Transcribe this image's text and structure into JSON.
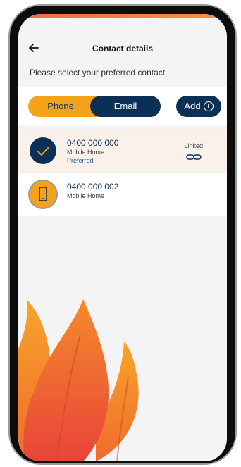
{
  "header": {
    "title": "Contact details"
  },
  "prompt": "Please select your preferred contact",
  "toggle": {
    "phone_label": "Phone",
    "email_label": "Email",
    "selected": "Email"
  },
  "add_button": {
    "label": "Add"
  },
  "contacts": [
    {
      "number": "0400 000 000",
      "type": "Mobile Home",
      "preferred_label": "Preferred",
      "linked_label": "Linked",
      "selected": true,
      "icon": "check-icon"
    },
    {
      "number": "0400 000 002",
      "type": "Mobile Home",
      "selected": false,
      "icon": "mobile-phone-icon"
    }
  ],
  "colors": {
    "navy": "#0b2f55",
    "orange": "#f5a21b",
    "flame_orange": "#f57d2a",
    "flame_red": "#e8443a"
  }
}
